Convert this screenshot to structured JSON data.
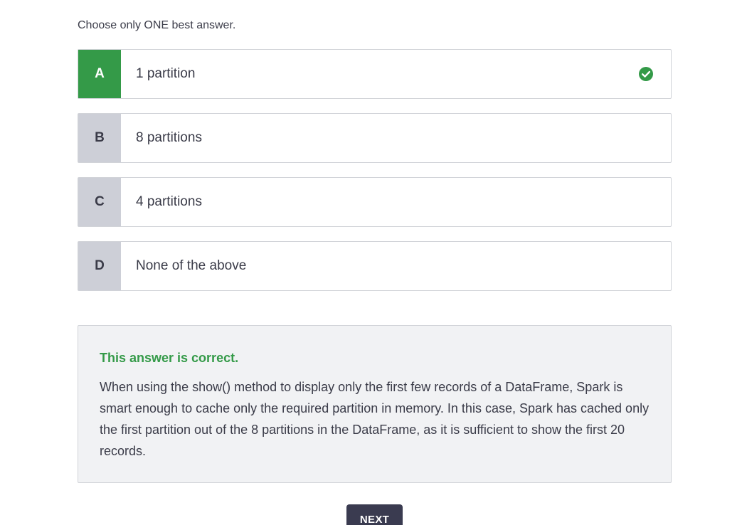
{
  "instruction": "Choose only ONE best answer.",
  "options": [
    {
      "letter": "A",
      "text": "1 partition",
      "state": "correct",
      "icon": "check-circle-icon"
    },
    {
      "letter": "B",
      "text": "8 partitions",
      "state": "default"
    },
    {
      "letter": "C",
      "text": "4 partitions",
      "state": "default"
    },
    {
      "letter": "D",
      "text": "None of the above",
      "state": "default"
    }
  ],
  "feedback": {
    "title": "This answer is correct.",
    "body": "When using the show() method to display only the first few records of a DataFrame, Spark is smart enough to cache only the required partition in memory. In this case, Spark has cached only the first partition out of the 8 partitions in the DataFrame, as it is sufficient to show the first 20 records."
  },
  "next_button": {
    "label": "NEXT"
  },
  "colors": {
    "correct": "#349a48",
    "letter_bg": "#cdcfd7",
    "text": "#3a3b48",
    "feedback_bg": "#f1f2f4",
    "button_bg": "#3a3b50"
  }
}
